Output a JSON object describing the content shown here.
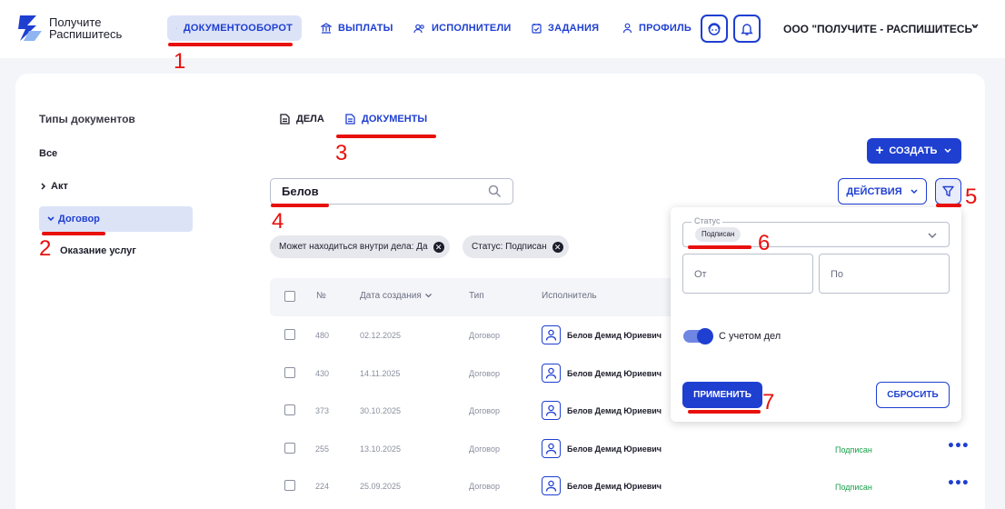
{
  "header": {
    "logo_line1": "Получите",
    "logo_line2": "Распишитесь",
    "nav": [
      {
        "label": "ДОКУМЕНТООБОРОТ",
        "icon": "document-icon",
        "active": true
      },
      {
        "label": "ВЫПЛАТЫ",
        "icon": "bank-icon",
        "active": false
      },
      {
        "label": "ИСПОЛНИТЕЛИ",
        "icon": "users-icon",
        "active": false
      },
      {
        "label": "ЗАДАНИЯ",
        "icon": "calendar-check-icon",
        "active": false
      },
      {
        "label": "ПРОФИЛЬ",
        "icon": "person-icon",
        "active": false
      }
    ],
    "org_name": "ООО \"ПОЛУЧИТЕ - РАСПИШИТЕСЬ\""
  },
  "sidebar": {
    "title": "Типы документов",
    "items": [
      {
        "label": "Все"
      },
      {
        "label": "Акт"
      },
      {
        "label": "Договор"
      },
      {
        "label": "Оказание услуг"
      }
    ]
  },
  "tabs": [
    {
      "label": "ДЕЛА"
    },
    {
      "label": "ДОКУМЕНТЫ"
    }
  ],
  "toolbar": {
    "create_label": "СОЗДАТЬ",
    "search_value": "Белов",
    "actions_label": "ДЕЙСТВИЯ"
  },
  "chips": [
    {
      "label": "Может находиться внутри дела: Да"
    },
    {
      "label": "Статус: Подписан"
    }
  ],
  "table": {
    "columns": [
      "№",
      "Дата создания",
      "Тип",
      "Исполнитель"
    ],
    "rows": [
      {
        "num": "480",
        "date": "02.12.2025",
        "type": "Договор",
        "performer": "Белов Демид Юриевич",
        "status": ""
      },
      {
        "num": "430",
        "date": "14.11.2025",
        "type": "Договор",
        "performer": "Белов Демид Юриевич",
        "status": ""
      },
      {
        "num": "373",
        "date": "30.10.2025",
        "type": "Договор",
        "performer": "Белов Демид Юриевич",
        "status": ""
      },
      {
        "num": "255",
        "date": "13.10.2025",
        "type": "Договор",
        "performer": "Белов Демид Юриевич",
        "status": "Подписан"
      },
      {
        "num": "224",
        "date": "25.09.2025",
        "type": "Договор",
        "performer": "Белов Демид Юриевич",
        "status": "Подписан"
      }
    ]
  },
  "filter_popup": {
    "status_label": "Статус",
    "status_value": "Подписан",
    "from_placeholder": "От",
    "to_placeholder": "По",
    "toggle_label": "С учетом дел",
    "toggle_on": true,
    "apply_label": "ПРИМЕНИТЬ",
    "reset_label": "СБРОСИТЬ"
  },
  "annotations": [
    "1",
    "2",
    "3",
    "4",
    "5",
    "6",
    "7"
  ],
  "colors": {
    "accent": "#1f3fd1",
    "annotation": "#e8100c",
    "status_signed": "#1aa04a"
  }
}
